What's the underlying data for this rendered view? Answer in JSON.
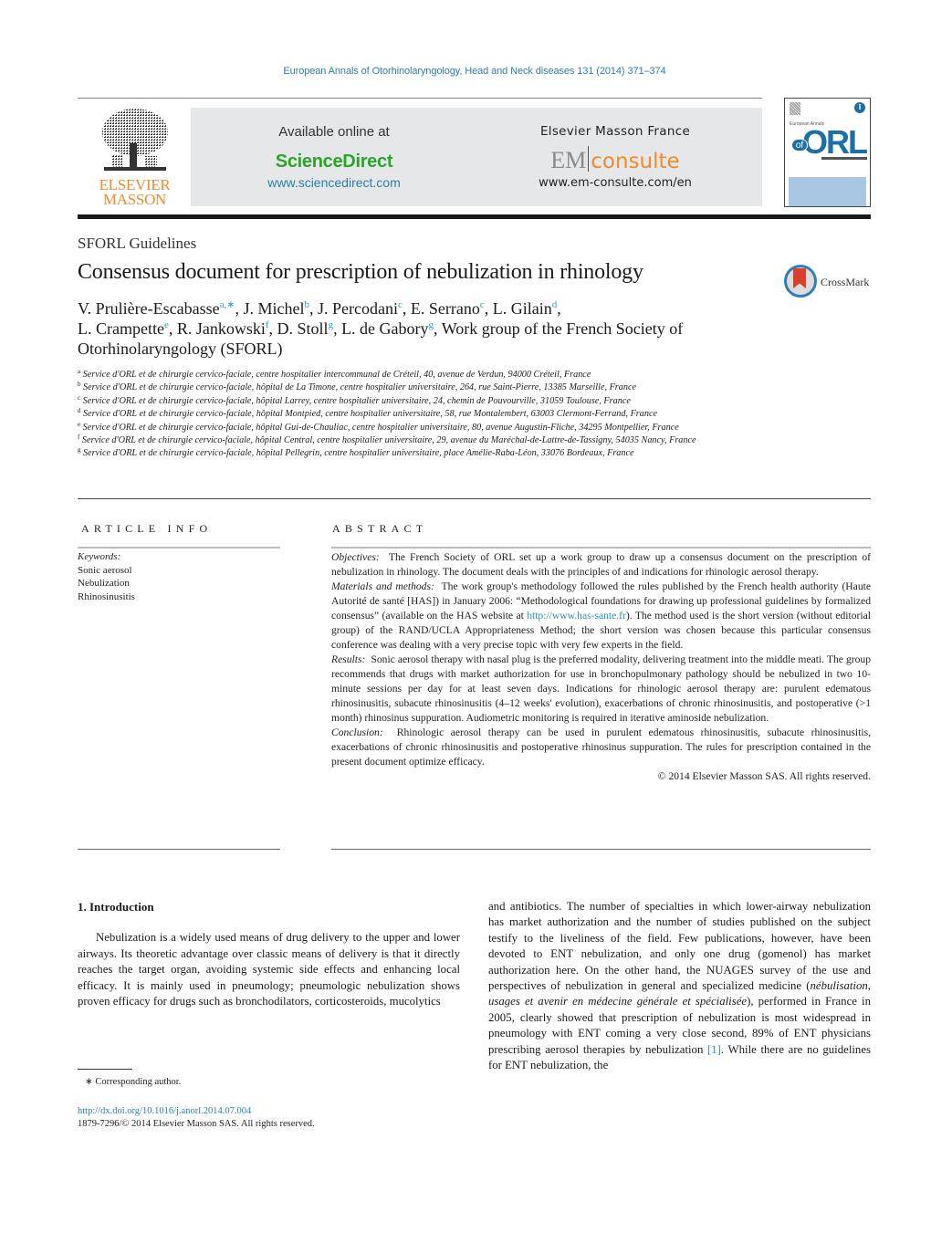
{
  "journal": {
    "citation": "European Annals of Otorhinolaryngology, Head and Neck diseases 131 (2014) 371–374"
  },
  "banner": {
    "publisher_logo": {
      "line1": "ELSEVIER",
      "line2": "MASSON"
    },
    "available_label": "Available online at",
    "sciencedirect_name": "ScienceDirect",
    "sciencedirect_url": "www.sciencedirect.com",
    "emf_label": "Elsevier Masson France",
    "em_logo_em": "EM",
    "em_logo_consulte": "consulte",
    "emconsulte_url": "www.em-consulte.com/en",
    "cover": {
      "small_text": "European Annals",
      "title": "ORL",
      "of": "of",
      "oa_badge": "i"
    }
  },
  "article": {
    "section": "SFORL Guidelines",
    "title": "Consensus document for prescription of nebulization in rhinology",
    "crossmark_label": "CrossMark",
    "authors": [
      {
        "name": "V. Prulière-Escabasse",
        "sup": "a,∗",
        "sep": ", "
      },
      {
        "name": "J. Michel",
        "sup": "b",
        "sep": ", "
      },
      {
        "name": "J. Percodani",
        "sup": "c",
        "sep": ", "
      },
      {
        "name": "E. Serrano",
        "sup": "c",
        "sep": ", "
      },
      {
        "name": "L. Gilain",
        "sup": "d",
        "sep": ","
      },
      {
        "name": "L. Crampette",
        "sup": "e",
        "sep": ", "
      },
      {
        "name": "R. Jankowski",
        "sup": "f",
        "sep": ", "
      },
      {
        "name": "D. Stoll",
        "sup": "g",
        "sep": ", "
      },
      {
        "name": "L. de Gabory",
        "sup": "g",
        "sep": ", "
      },
      {
        "name": "Work group of the French Society of Otorhinolaryngology (SFORL)",
        "sup": "",
        "sep": ""
      }
    ],
    "affiliations": [
      {
        "key": "a",
        "text": "Service d'ORL et de chirurgie cervico-faciale, centre hospitalier intercommunal de Créteil, 40, avenue de Verdun, 94000 Créteil, France"
      },
      {
        "key": "b",
        "text": "Service d'ORL et de chirurgie cervico-faciale, hôpital de La Timone, centre hospitalier universitaire, 264, rue Saint-Pierre, 13385 Marseille, France"
      },
      {
        "key": "c",
        "text": "Service d'ORL et de chirurgie cervico-faciale, hôpital Larrey, centre hospitalier universitaire, 24, chemin de Pouvourville, 31059 Toulouse, France"
      },
      {
        "key": "d",
        "text": "Service d'ORL et de chirurgie cervico-faciale, hôpital Montpied, centre hospitalier universitaire, 58, rue Montalembert, 63003 Clermont-Ferrand, France"
      },
      {
        "key": "e",
        "text": "Service d'ORL et de chirurgie cervico-faciale, hôpital Gui-de-Chauliac, centre hospitalier universitaire, 80, avenue Augustin-Fliche, 34295 Montpellier, France"
      },
      {
        "key": "f",
        "text": "Service d'ORL et de chirurgie cervico-faciale, hôpital Central, centre hospitalier universitaire, 29, avenue du Maréchal-de-Lattre-de-Tassigny, 54035 Nancy, France"
      },
      {
        "key": "g",
        "text": "Service d'ORL et de chirurgie cervico-faciale, hôpital Pellegrin, centre hospitalier universitaire, place Amélie-Raba-Léon, 33076 Bordeaux, France"
      }
    ]
  },
  "article_info": {
    "heading": "ARTICLE INFO",
    "keywords_label": "Keywords:",
    "keywords": [
      "Sonic aerosol",
      "Nebulization",
      "Rhinosinusitis"
    ]
  },
  "abstract": {
    "heading": "ABSTRACT",
    "objectives_label": "Objectives:",
    "objectives": "The French Society of ORL set up a work group to draw up a consensus document on the prescription of nebulization in rhinology. The document deals with the principles of and indications for rhinologic aerosol therapy.",
    "methods_label": "Materials and methods:",
    "methods_before_link": "The work group's methodology followed the rules published by the French health authority (Haute Autorité de santé [HAS]) in January 2006: “Methodological foundations for drawing up professional guidelines by formalized consensus” (available on the HAS website at ",
    "methods_link": "http://www.has-sante.fr",
    "methods_after_link": "). The method used is the short version (without editorial group) of the RAND/UCLA Appropriateness Method; the short version was chosen because this particular consensus conference was dealing with a very precise topic with very few experts in the field.",
    "results_label": "Results:",
    "results": "Sonic aerosol therapy with nasal plug is the preferred modality, delivering treatment into the middle meati. The group recommends that drugs with market authorization for use in bronchopulmonary pathology should be nebulized in two 10-minute sessions per day for at least seven days. Indications for rhinologic aerosol therapy are: purulent edematous rhinosinusitis, subacute rhinosinusitis (4–12 weeks' evolution), exacerbations of chronic rhinosinusitis, and postoperative (>1 month) rhinosinus suppuration. Audiometric monitoring is required in iterative aminoside nebulization.",
    "conclusion_label": "Conclusion:",
    "conclusion": "Rhinologic aerosol therapy can be used in purulent edematous rhinosinusitis, subacute rhinosinusitis, exacerbations of chronic rhinosinusitis and postoperative rhinosinus suppuration. The rules for prescription contained in the present document optimize efficacy.",
    "copyright": "© 2014 Elsevier Masson SAS. All rights reserved."
  },
  "body": {
    "section_heading": "1.  Introduction",
    "left_paragraph": "Nebulization is a widely used means of drug delivery to the upper and lower airways. Its theoretic advantage over classic means of delivery is that it directly reaches the target organ, avoiding systemic side effects and enhancing local efficacy. It is mainly used in pneumology; pneumologic nebulization shows proven efficacy for drugs such as bronchodilators, corticosteroids, mucolytics",
    "right_before_italic": "and antibiotics. The number of specialties in which lower-airway nebulization has market authorization and the number of studies published on the subject testify to the liveliness of the field. Few publications, however, have been devoted to ENT nebulization, and only one drug (gomenol) has market authorization here. On the other hand, the NUAGES survey of the use and perspectives of nebulization in general and specialized medicine (",
    "right_italic": "nébulisation, usages et avenir en médecine générale et spécialisée",
    "right_after_italic": "), performed in France in 2005, clearly showed that prescription of nebulization is most widespread in pneumology with ENT coming a very close second, 89% of ENT physicians prescribing aerosol therapies by nebulization ",
    "right_citation": "[1]",
    "right_end": ". While there are no guidelines for ENT nebulization, the"
  },
  "footer": {
    "footnote": "∗  Corresponding author.",
    "doi": "http://dx.doi.org/10.1016/j.anorl.2014.07.004",
    "issn": "1879-7296/© 2014 Elsevier Masson SAS. All rights reserved."
  }
}
